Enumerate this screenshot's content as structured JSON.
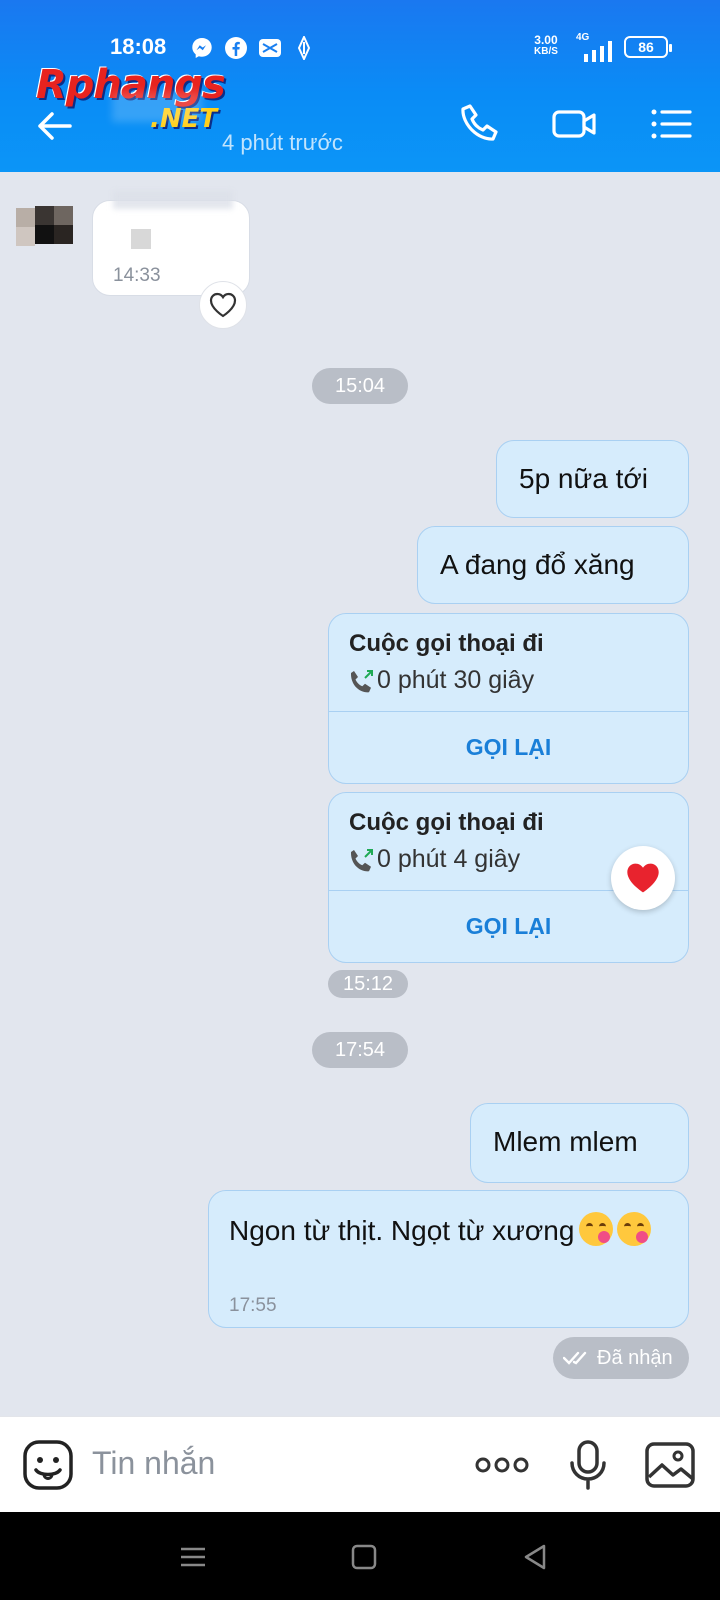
{
  "status_bar": {
    "time": "18:08",
    "net_speed_value": "3.00",
    "net_speed_unit": "KB/S",
    "network": "4G",
    "battery": "86",
    "icons": [
      "messenger-icon",
      "facebook-icon",
      "capcut-icon",
      "app-icon"
    ]
  },
  "watermark": {
    "brand": "Rphangs",
    "suffix": ".NET"
  },
  "header": {
    "subtitle": "4 phút trước",
    "accent": "#0a8cf6"
  },
  "messages": {
    "received": {
      "time": "14:33"
    },
    "pill_1": "15:04",
    "sent_1": "5p nữa tới",
    "sent_2": "A đang đổ xăng",
    "call_1": {
      "title": "Cuộc gọi thoại đi",
      "duration": "0 phút 30 giây",
      "action": "GỌI LẠI"
    },
    "call_2": {
      "title": "Cuộc gọi thoại đi",
      "duration": "0 phút 4 giây",
      "action": "GỌI LẠI"
    },
    "call_time": "15:12",
    "pill_2": "17:54",
    "sent_3": "Mlem mlem",
    "sent_4": {
      "text": "Ngon từ thịt. Ngọt từ xương",
      "time": "17:55"
    },
    "status": "Đã nhận"
  },
  "input": {
    "placeholder": "Tin nhắn"
  },
  "colors": {
    "bubble_sent": "#d6ecfc",
    "link": "#1a7fd8",
    "background": "#e2e6ee"
  }
}
